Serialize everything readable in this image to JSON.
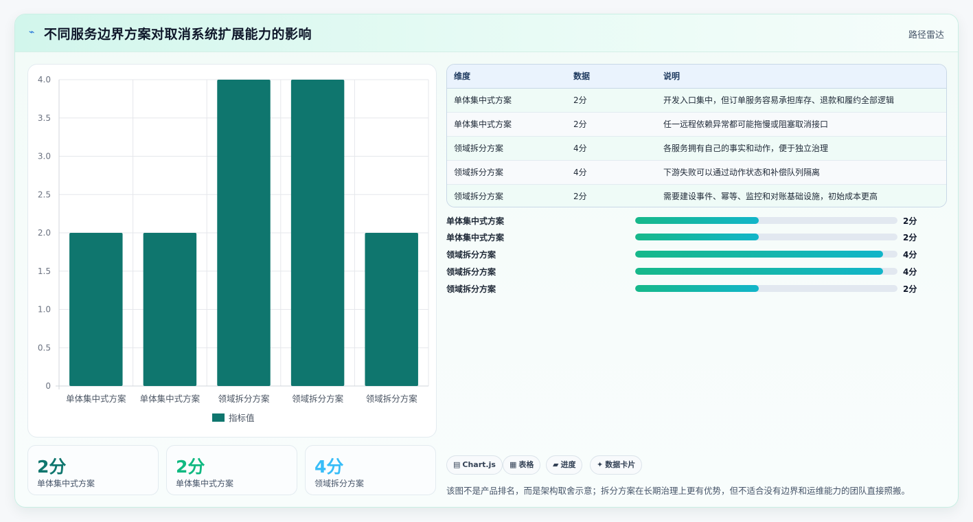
{
  "header": {
    "title": "不同服务边界方案对取消系统扩展能力的影响",
    "icon": "lightning-icon",
    "right_label": "路径雷达"
  },
  "colors": {
    "bar": "#0f766e",
    "kpi_1": "#0f766e",
    "kpi_2": "#10b981",
    "kpi_3": "#38bdf8",
    "progress_start": "#16b88a",
    "progress_end": "#12b5c9"
  },
  "chart_data": {
    "type": "bar",
    "categories": [
      "单体集中式方案",
      "单体集中式方案",
      "领域拆分方案",
      "领域拆分方案",
      "领域拆分方案"
    ],
    "series": [
      {
        "name": "指标值",
        "values": [
          2,
          2,
          4,
          4,
          2
        ]
      }
    ],
    "ylim": [
      0,
      4
    ],
    "yticks": [
      "0",
      "0.5",
      "1.0",
      "1.5",
      "2.0",
      "2.5",
      "3.0",
      "3.5",
      "4.0"
    ],
    "grid": true,
    "legend": "bottom"
  },
  "kpis": [
    {
      "value": "2分",
      "label": "单体集中式方案"
    },
    {
      "value": "2分",
      "label": "单体集中式方案"
    },
    {
      "value": "4分",
      "label": "领域拆分方案"
    }
  ],
  "table": {
    "headers": [
      "维度",
      "数据",
      "说明"
    ],
    "rows": [
      [
        "单体集中式方案",
        "2分",
        "开发入口集中，但订单服务容易承担库存、退款和履约全部逻辑"
      ],
      [
        "单体集中式方案",
        "2分",
        "任一远程依赖异常都可能拖慢或阻塞取消接口"
      ],
      [
        "领域拆分方案",
        "4分",
        "各服务拥有自己的事实和动作，便于独立治理"
      ],
      [
        "领域拆分方案",
        "4分",
        "下游失败可以通过动作状态和补偿队列隔离"
      ],
      [
        "领域拆分方案",
        "2分",
        "需要建设事件、幂等、监控和对账基础设施，初始成本更高"
      ]
    ]
  },
  "progress": {
    "max": 4,
    "items": [
      {
        "label": "单体集中式方案",
        "value": 2,
        "text": "2分"
      },
      {
        "label": "单体集中式方案",
        "value": 2,
        "text": "2分"
      },
      {
        "label": "领域拆分方案",
        "value": 4,
        "text": "4分"
      },
      {
        "label": "领域拆分方案",
        "value": 4,
        "text": "4分"
      },
      {
        "label": "领域拆分方案",
        "value": 2,
        "text": "2分"
      }
    ]
  },
  "chips": [
    {
      "icon": "▤",
      "label": "Chart.js"
    },
    {
      "icon": "▦",
      "label": "表格"
    },
    {
      "icon": "▰",
      "label": "进度"
    },
    {
      "icon": "✦",
      "label": "数据卡片"
    }
  ],
  "note": "该图不是产品排名，而是架构取舍示意；拆分方案在长期治理上更有优势，但不适合没有边界和运维能力的团队直接照搬。"
}
